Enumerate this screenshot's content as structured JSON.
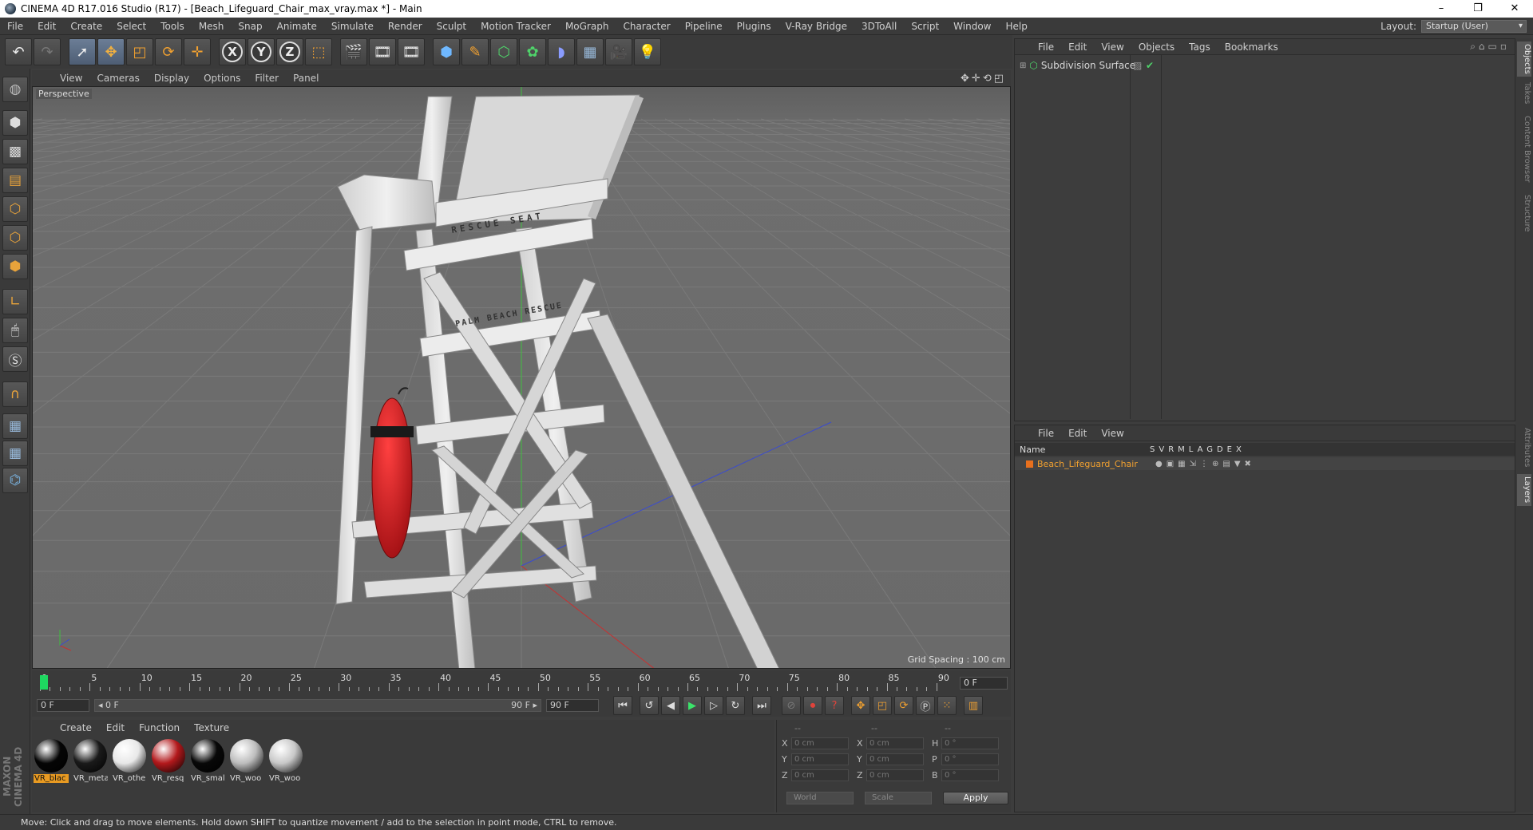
{
  "window": {
    "title": "CINEMA 4D R17.016 Studio (R17) - [Beach_Lifeguard_Chair_max_vray.max *] - Main",
    "minimize": "–",
    "restore": "❐",
    "close": "✕"
  },
  "menu": {
    "items": [
      "File",
      "Edit",
      "Create",
      "Select",
      "Tools",
      "Mesh",
      "Snap",
      "Animate",
      "Simulate",
      "Render",
      "Sculpt",
      "Motion Tracker",
      "MoGraph",
      "Character",
      "Pipeline",
      "Plugins",
      "V-Ray Bridge",
      "3DToAll",
      "Script",
      "Window",
      "Help"
    ],
    "layout_label": "Layout:",
    "layout_value": "Startup (User)"
  },
  "toolbar": {
    "axis_x": "X",
    "axis_y": "Y",
    "axis_z": "Z"
  },
  "viewport": {
    "menu": [
      "View",
      "Cameras",
      "Display",
      "Options",
      "Filter",
      "Panel"
    ],
    "nav_icons": "✥✛⟲◰",
    "camera_label": "Perspective",
    "grid_spacing": "Grid Spacing : 100 cm",
    "sign_top": "RESCUE SEAT",
    "sign_bottom": "PALM BEACH RESCUE"
  },
  "timeline": {
    "ticks": [
      "0",
      "5",
      "10",
      "15",
      "20",
      "25",
      "30",
      "35",
      "40",
      "45",
      "50",
      "55",
      "60",
      "65",
      "70",
      "75",
      "80",
      "85",
      "90"
    ],
    "current_frame": "0 F"
  },
  "transport": {
    "start_field": "0 F",
    "range_start": "◂ 0 F",
    "range_end": "90 F ▸",
    "end_field": "90 F"
  },
  "materials": {
    "menu": [
      "Create",
      "Edit",
      "Function",
      "Texture"
    ],
    "items": [
      {
        "name": "VR_blac",
        "color": "#050505",
        "active": true
      },
      {
        "name": "VR_meta",
        "color": "#1a1a1a",
        "active": false
      },
      {
        "name": "VR_othe",
        "color": "#e8e8e8",
        "active": false
      },
      {
        "name": "VR_resq",
        "color": "#b3191c",
        "active": false
      },
      {
        "name": "VR_smal",
        "color": "#080808",
        "active": false
      },
      {
        "name": "VR_woo",
        "color": "#bdbdbd",
        "active": false
      },
      {
        "name": "VR_woo",
        "color": "#c8c8c8",
        "active": false
      }
    ]
  },
  "coordinates": {
    "headers": [
      "--",
      "--",
      "--"
    ],
    "rows": [
      {
        "a": "X",
        "av": "0 cm",
        "b": "X",
        "bv": "0 cm",
        "c": "H",
        "cv": "0 °"
      },
      {
        "a": "Y",
        "av": "0 cm",
        "b": "Y",
        "bv": "0 cm",
        "c": "P",
        "cv": "0 °"
      },
      {
        "a": "Z",
        "av": "0 cm",
        "b": "Z",
        "bv": "0 cm",
        "c": "B",
        "cv": "0 °"
      }
    ],
    "mode": "World",
    "scale": "Scale",
    "apply": "Apply"
  },
  "objects_panel": {
    "menu": [
      "File",
      "Edit",
      "View",
      "Objects",
      "Tags",
      "Bookmarks"
    ],
    "object_name": "Subdivision Surface"
  },
  "layers_panel": {
    "menu": [
      "File",
      "Edit",
      "View"
    ],
    "col_name": "Name",
    "col_flags": "SVRMLAGDEX",
    "layer_name": "Beach_Lifeguard_Chair"
  },
  "side_tabs": [
    "Objects",
    "Takes",
    "Content Browser",
    "Structure",
    "Attributes",
    "Layers"
  ],
  "brand": "MAXON CINEMA 4D",
  "status": "Move: Click and drag to move elements. Hold down SHIFT to quantize movement / add to the selection in point mode, CTRL to remove.",
  "colors": {
    "accent": "#e89a22",
    "playhead": "#1ed760",
    "selected_tool": "#5a6d88"
  }
}
